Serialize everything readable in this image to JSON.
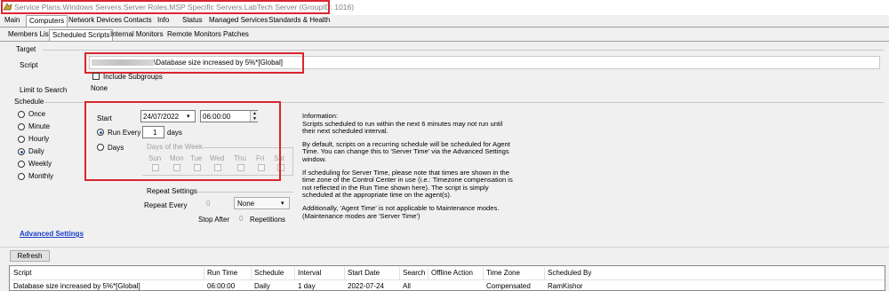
{
  "window": {
    "title": "Service Plans.Windows Servers.Server Roles.MSP Specific Servers.LabTech Server   (GroupID: 1016)",
    "icon": "app-icon"
  },
  "menu_tabs": [
    "Main",
    "Computers",
    "Network Devices",
    "Contacts",
    "Info",
    "Status",
    "Managed Services",
    "Standards & Health"
  ],
  "active_menu_tab": "Computers",
  "sub_tabs": [
    "Members List",
    "Scheduled Scripts",
    "Internal Monitors",
    "Remote Monitors",
    "Patches"
  ],
  "active_sub_tab": "Scheduled Scripts",
  "target": {
    "header": "Target",
    "script_label": "Script",
    "script_value": "\\Database size increased by 5%*[Global]",
    "include_subgroups_label": "Include Subgroups",
    "include_subgroups_checked": false,
    "limit_label": "Limit to Search",
    "limit_value": "None"
  },
  "schedule": {
    "header": "Schedule",
    "options": [
      "Once",
      "Minute",
      "Hourly",
      "Daily",
      "Weekly",
      "Monthly"
    ],
    "selected": "Daily",
    "start_label": "Start",
    "start_date": "24/07/2022",
    "start_time": "06:00:00",
    "run_every_label": "Run Every",
    "run_every_value": "1",
    "run_every_unit": "days",
    "days_label": "Days",
    "days_of_week_label": "Days of the Week",
    "days_of_week": [
      "Sun",
      "Mon",
      "Tue",
      "Wed",
      "Thu",
      "Fri",
      "Sat"
    ],
    "repeat_header": "Repeat Settings",
    "repeat_every_label": "Repeat Every",
    "repeat_every_value": "0",
    "repeat_unit": "None",
    "stop_after_label": "Stop After",
    "stop_after_value": "0",
    "repetitions_label": "Repetitions"
  },
  "info": {
    "p1": "Information:\nScripts scheduled to run within the next 6 minutes may not run until their next scheduled interval.",
    "p2": "By default, scripts on a recurring schedule will be scheduled for Agent Time. You can change this to 'Server Time' via the Advanced Settings window.",
    "p3": "If scheduling for Server Time, please note that times are shown in the time zone of the Control Center in use (i.e.: Timezone compensation is not reflected in the Run Time shown here). The script is simply scheduled at the appropriate time on the agent(s).",
    "p4": "Additionally, 'Agent Time' is not applicable to Maintenance modes. (Maintenance modes are 'Server Time')"
  },
  "advanced_settings_label": "Advanced Settings",
  "refresh_label": "Refresh",
  "grid": {
    "columns": [
      "Script",
      "Run Time",
      "Schedule",
      "Interval",
      "Start Date",
      "Search",
      "Offline Action",
      "Time Zone",
      "Scheduled By"
    ],
    "rows": [
      [
        "Database size increased by 5%*[Global]",
        "06:00:00",
        "Daily",
        "1 day",
        "2022-07-24",
        "All",
        "",
        "Compensated",
        "RamKishor"
      ]
    ]
  },
  "colors": {
    "highlight_red": "#d9262e",
    "link_blue": "#1a3fc8"
  }
}
